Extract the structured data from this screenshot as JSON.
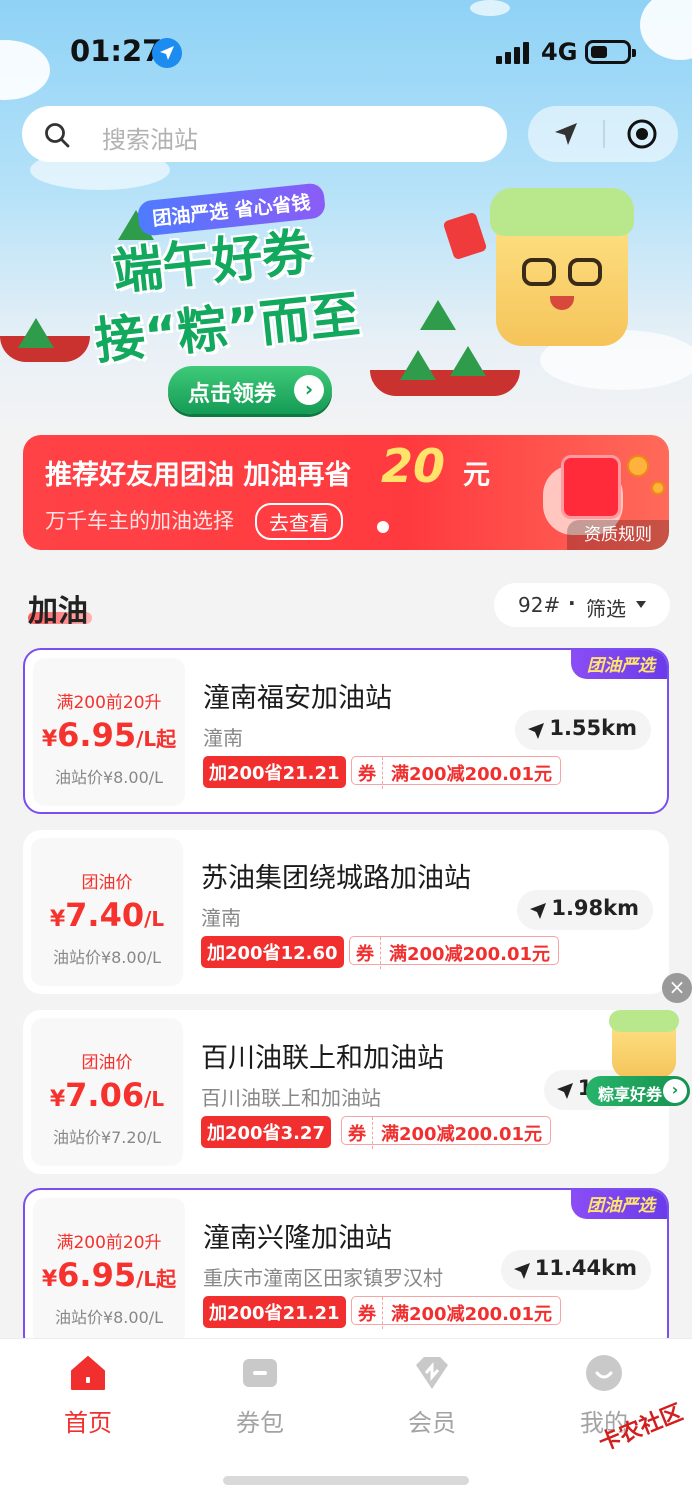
{
  "status": {
    "time": "01:27",
    "network": "4G"
  },
  "search": {
    "placeholder": "搜索油站"
  },
  "banner": {
    "tag": "团油严选 省心省钱",
    "title_line1": "端午好券",
    "title_line2": "接“粽”而至",
    "cta": "点击领券"
  },
  "promo": {
    "headline": "推荐好友用团油 加油再省",
    "amount": "20",
    "unit": "元",
    "subtitle": "万千车主的加油选择",
    "link": "去查看",
    "rules": "资质规则"
  },
  "section": {
    "title": "加油",
    "filter_grade": "92#",
    "filter_sep": "·",
    "filter_label": "筛选"
  },
  "stations": [
    {
      "badge": "团油严选",
      "price_label": "满200前20升",
      "currency": "¥",
      "price": "6.95",
      "unit": "/L起",
      "station_price": "油站价¥8.00/L",
      "name": "潼南福安加油站",
      "address": "潼南",
      "distance": "1.55km",
      "save": "加200省21.21",
      "coupon_tag": "券",
      "coupon_text": "满200减200.01元"
    },
    {
      "badge": "",
      "price_label": "团油价",
      "currency": "¥",
      "price": "7.40",
      "unit": "/L",
      "station_price": "油站价¥8.00/L",
      "name": "苏油集团绕城路加油站",
      "address": "潼南",
      "distance": "1.98km",
      "save": "加200省12.60",
      "coupon_tag": "券",
      "coupon_text": "满200减200.01元"
    },
    {
      "badge": "",
      "price_label": "团油价",
      "currency": "¥",
      "price": "7.06",
      "unit": "/L",
      "station_price": "油站价¥7.20/L",
      "name": "百川油联上和加油站",
      "address": "百川油联上和加油站",
      "distance": "10.",
      "save": "加200省3.27",
      "coupon_tag": "券",
      "coupon_text": "满200减200.01元"
    },
    {
      "badge": "团油严选",
      "price_label": "满200前20升",
      "currency": "¥",
      "price": "6.95",
      "unit": "/L起",
      "station_price": "油站价¥8.00/L",
      "name": "潼南兴隆加油站",
      "address": "重庆市潼南区田家镇罗汉村",
      "distance": "11.44km",
      "save": "加200省21.21",
      "coupon_tag": "券",
      "coupon_text": "满200减200.01元"
    }
  ],
  "float_ad": {
    "label": "粽享好券",
    "close": "×"
  },
  "tabs": [
    {
      "label": "首页",
      "icon": "home-icon",
      "active": true
    },
    {
      "label": "券包",
      "icon": "coupon-wallet-icon",
      "active": false
    },
    {
      "label": "会员",
      "icon": "member-icon",
      "active": false
    },
    {
      "label": "我的",
      "icon": "profile-icon",
      "active": false
    }
  ],
  "watermark": "卡农社区",
  "colors": {
    "accent_red": "#f12f2f",
    "brand_green": "#12a85d",
    "featured_purple": "#7a4ef0"
  }
}
